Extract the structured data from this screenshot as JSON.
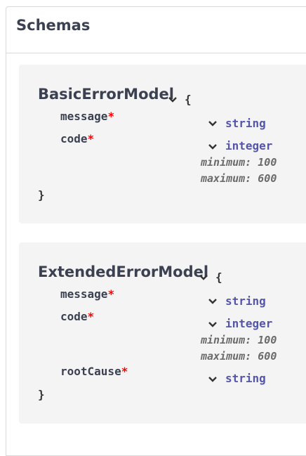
{
  "section": {
    "title": "Schemas"
  },
  "models": [
    {
      "name": "BasicErrorModel",
      "open_brace": "{",
      "close_brace": "}",
      "properties": [
        {
          "name": "message",
          "required_mark": "*",
          "type": "string"
        },
        {
          "name": "code",
          "required_mark": "*",
          "type": "integer",
          "minimum": "minimum: 100",
          "maximum": "maximum: 600"
        }
      ]
    },
    {
      "name": "ExtendedErrorModel",
      "open_brace": "{",
      "close_brace": "}",
      "properties": [
        {
          "name": "message",
          "required_mark": "*",
          "type": "string"
        },
        {
          "name": "code",
          "required_mark": "*",
          "type": "integer",
          "minimum": "minimum: 100",
          "maximum": "maximum: 600"
        },
        {
          "name": "rootCause",
          "required_mark": "*",
          "type": "string"
        }
      ]
    }
  ],
  "colors": {
    "title": "#3b4151",
    "type": "#5555aa",
    "required": "#ff0000",
    "constraint": "#6b6b6b"
  }
}
